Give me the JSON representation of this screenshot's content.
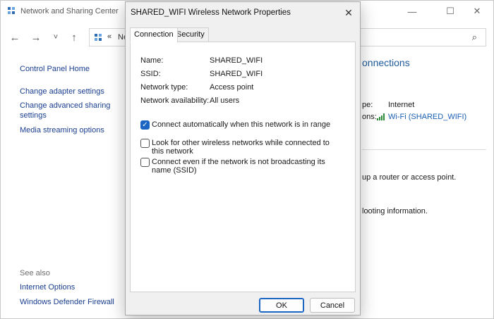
{
  "bg_window": {
    "title": "Network and Sharing Center",
    "minimize_icon": "minimize-icon",
    "maximize_icon": "maximize-icon",
    "close_icon": "close-icon"
  },
  "nav": {
    "back": "←",
    "forward": "→",
    "recent": "˅",
    "up": "↑",
    "address_chevron": "«",
    "address_text": "Ne",
    "search_glyph": "⌕"
  },
  "sidebar": {
    "control_panel_home": "Control Panel Home",
    "change_adapter": "Change adapter settings",
    "change_advanced_line1": "Change advanced sharing",
    "change_advanced_line2": "settings",
    "media_streaming": "Media streaming options",
    "see_also": "See also",
    "internet_options": "Internet Options",
    "defender_firewall": "Windows Defender Firewall"
  },
  "content": {
    "heading": "onnections",
    "access_type_label": "pe:",
    "access_type_value": "Internet",
    "connections_label": "ons:",
    "connection_link": "Wi-Fi (SHARED_WIFI)",
    "router_text": "up a router or access point.",
    "troubleshoot_text": "looting information."
  },
  "dialog": {
    "title": "SHARED_WIFI Wireless Network Properties",
    "tabs": [
      "Connection",
      "Security"
    ],
    "fields": [
      {
        "label": "Name:",
        "value": "SHARED_WIFI"
      },
      {
        "label": "SSID:",
        "value": "SHARED_WIFI"
      },
      {
        "label": "Network type:",
        "value": "Access point"
      },
      {
        "label": "Network availability:",
        "value": "All users"
      }
    ],
    "options": [
      {
        "text": "Connect automatically when this network is in range",
        "checked": true
      },
      {
        "text": "Look for other wireless networks while connected to this network",
        "checked": false
      },
      {
        "text": "Connect even if the network is not broadcasting its name (SSID)",
        "checked": false
      }
    ],
    "ok_label": "OK",
    "cancel_label": "Cancel",
    "close_glyph": "✕"
  },
  "colors": {
    "link": "#1a3e8f",
    "accent": "#1a66c2",
    "heading": "#1e5a9a"
  }
}
